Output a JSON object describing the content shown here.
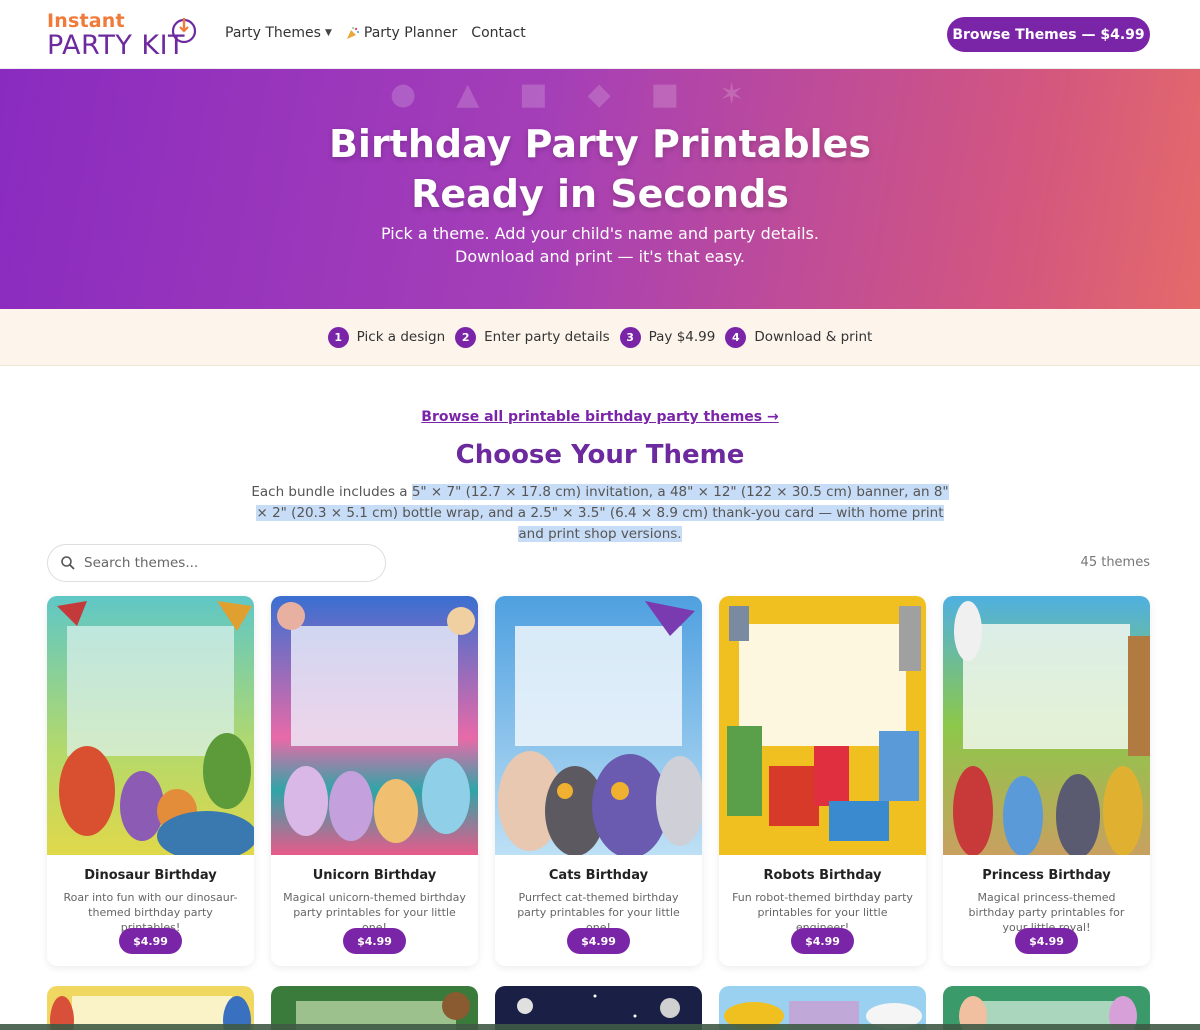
{
  "header": {
    "logo_top": "Instant",
    "logo_bottom": "PARTY KIT",
    "nav": [
      {
        "label": "Party Themes",
        "icon": "chevron-down-icon"
      },
      {
        "label": "Party Planner",
        "icon": "party-popper-icon"
      },
      {
        "label": "Contact"
      }
    ],
    "cta_label": "Browse Themes — $4.99"
  },
  "hero": {
    "title_line1": "Birthday Party Printables",
    "title_line2": "Ready in Seconds",
    "subtitle": "Pick a theme. Add your child's name and party details. Download and print — it's that easy."
  },
  "steps": [
    {
      "num": "1",
      "label": "Pick a design"
    },
    {
      "num": "2",
      "label": "Enter party details"
    },
    {
      "num": "3",
      "label": "Pay $4.99"
    },
    {
      "num": "4",
      "label": "Download & print"
    }
  ],
  "section": {
    "browse_link": "Browse all printable birthday party themes →",
    "title": "Choose Your Theme",
    "desc_plain": "Each bundle includes a ",
    "desc_highlight": "5\" × 7\" (12.7 × 17.8 cm) invitation, a 48\" × 12\" (122 × 30.5 cm) banner, an 8\" × 2\" (20.3 × 5.1 cm) bottle wrap, and a 2.5\" × 3.5\" (6.4 × 8.9 cm) thank-you card — with home print and print shop versions.",
    "search_placeholder": "Search themes...",
    "count": "45 themes"
  },
  "themes": [
    {
      "title": "Dinosaur Birthday",
      "desc": "Roar into fun with our dinosaur-themed birthday party printables!",
      "price": "$4.99"
    },
    {
      "title": "Unicorn Birthday",
      "desc": "Magical unicorn-themed birthday party printables for your little one!",
      "price": "$4.99"
    },
    {
      "title": "Cats Birthday",
      "desc": "Purrfect cat-themed birthday party printables for your little one!",
      "price": "$4.99"
    },
    {
      "title": "Robots Birthday",
      "desc": "Fun robot-themed birthday party printables for your little engineer!",
      "price": "$4.99"
    },
    {
      "title": "Princess Birthday",
      "desc": "Magical princess-themed birthday party printables for your little royal!",
      "price": "$4.99"
    }
  ],
  "colors": {
    "brand_purple": "#7a25a8",
    "brand_orange": "#f07a3a",
    "steps_bg": "#fdf5ec"
  }
}
